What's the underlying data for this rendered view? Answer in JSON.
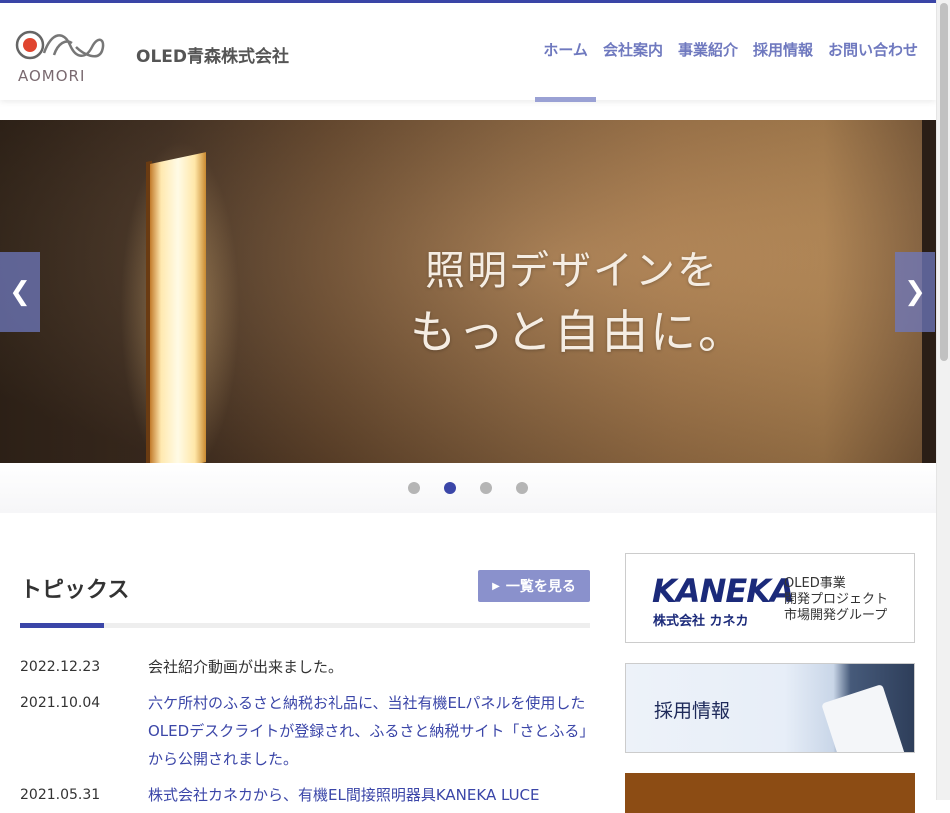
{
  "header": {
    "logo_text": "AOMORI",
    "company_name": "OLED青森株式会社",
    "nav": [
      {
        "label": "ホーム",
        "active": true
      },
      {
        "label": "会社案内",
        "active": false
      },
      {
        "label": "事業紹介",
        "active": false
      },
      {
        "label": "採用情報",
        "active": false
      },
      {
        "label": "お問い合わせ",
        "active": false
      }
    ]
  },
  "hero": {
    "line1": "照明デザインを",
    "line2": "もっと自由に。",
    "prev_icon": "chevron-left-icon",
    "next_icon": "chevron-right-icon",
    "slide_count": 4,
    "active_slide": 2
  },
  "topics": {
    "title": "トピックス",
    "view_all": "一覧を見る",
    "items": [
      {
        "date": "2022.12.23",
        "text": "会社紹介動画が出来ました。",
        "link": false
      },
      {
        "date": "2021.10.04",
        "text": "六ケ所村のふるさと納税お礼品に、当社有機ELパネルを使用したOLEDデスクライトが登録され、ふるさと納税サイト「さとふる」から公開されました。",
        "link": true
      },
      {
        "date": "2021.05.31",
        "text": "株式会社カネカから、有機EL間接照明器具KANEKA LUCE",
        "link": true
      }
    ]
  },
  "sidebar": {
    "kaneka_logo": "KANEKA",
    "kaneka_company": "株式会社 カネカ",
    "kaneka_desc": [
      "OLED事業",
      "開発プロジェクト",
      "市場開発グループ"
    ],
    "recruit_label": "採用情報"
  },
  "colors": {
    "accent": "#3b46a8",
    "nav": "#6f79bf",
    "button": "#8a91cc"
  }
}
